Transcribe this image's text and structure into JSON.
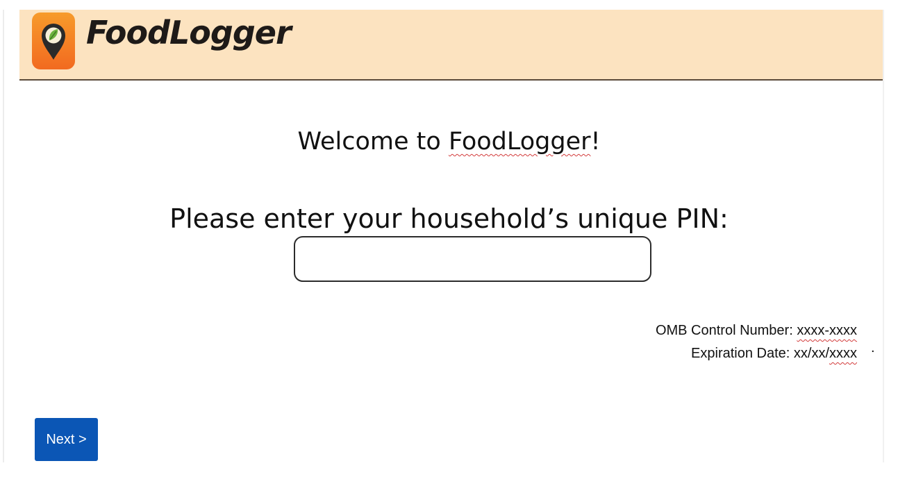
{
  "header": {
    "app_name": "FoodLogger",
    "logo_icon": "map-pin-leaf-icon",
    "background_color": "#fce3c0"
  },
  "main": {
    "welcome_prefix": "Welcome to ",
    "welcome_name": "FoodLogger",
    "welcome_suffix": "!",
    "pin_prompt": "Please enter your household’s unique PIN:",
    "pin_value": ""
  },
  "omb": {
    "control_prefix": "OMB Control Number: ",
    "control_value": "xxxx-xxxx",
    "expiration_prefix": "Expiration Date: xx/xx/",
    "expiration_value": "xxxx",
    "trailing_dot": "."
  },
  "footer": {
    "next_label": "Next >",
    "next_color": "#0b56b5"
  }
}
